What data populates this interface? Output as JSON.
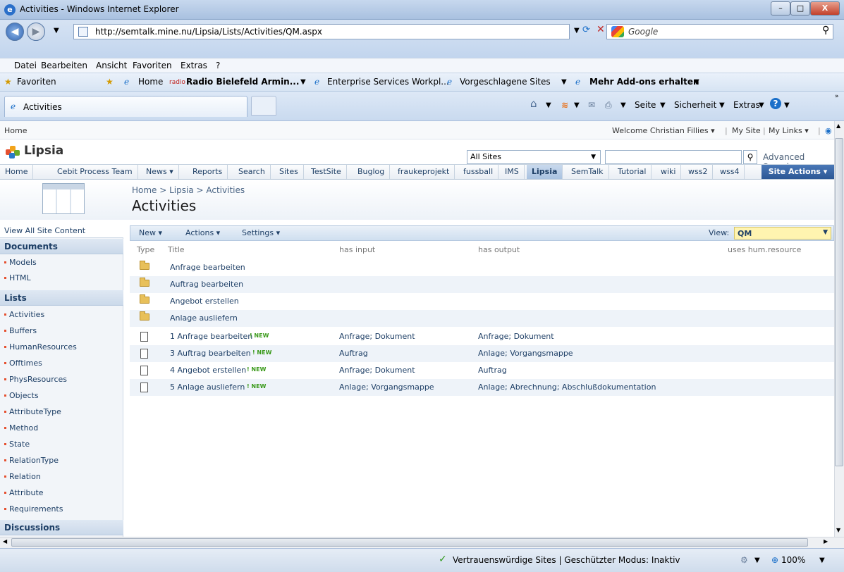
{
  "window": {
    "title": "Activities - Windows Internet Explorer",
    "minimize": "–",
    "maximize": "□",
    "close": "X"
  },
  "address": {
    "url": "http://semtalk.mine.nu/Lipsia/Lists/Activities/QM.aspx",
    "search_placeholder": "Google"
  },
  "menu": [
    "Datei",
    "Bearbeiten",
    "Ansicht",
    "Favoriten",
    "Extras",
    "?"
  ],
  "favorites": {
    "label": "Favoriten",
    "items": [
      "Home",
      "Radio Bielefeld Armin...",
      "Enterprise Services Workpl...",
      "Vorgeschlagene Sites",
      "Mehr Add-ons erhalten"
    ]
  },
  "tab": {
    "title": "Activities"
  },
  "commandbar": {
    "page": "Seite",
    "safety": "Sicherheit",
    "tools": "Extras"
  },
  "sp": {
    "breadcrumb_home": "Home",
    "welcome": "Welcome Christian Fillies ▾",
    "my_site": "My Site",
    "my_links": "My Links ▾",
    "site_title": "Lipsia",
    "scope": "All Sites",
    "advanced_search": "Advanced Search",
    "topnav": [
      "Home",
      "Cebit Process Team",
      "News ▾",
      "Reports",
      "Search",
      "Sites",
      "TestSite",
      "Buglog",
      "fraukeprojekt",
      "fussball",
      "IMS",
      "Lipsia",
      "SemTalk",
      "Tutorial",
      "wiki",
      "wss2",
      "wss4"
    ],
    "site_actions": "Site Actions ▾",
    "crumb": "Home > Lipsia > Activities",
    "page_title": "Activities"
  },
  "leftnav": {
    "view_all": "View All Site Content",
    "documents_header": "Documents",
    "documents": [
      "Models",
      "HTML"
    ],
    "lists_header": "Lists",
    "lists": [
      "Activities",
      "Buffers",
      "HumanResources",
      "Offtimes",
      "PhysResources",
      "Objects",
      "AttributeType",
      "Method",
      "State",
      "RelationType",
      "Relation",
      "Attribute",
      "Requirements"
    ],
    "discussions_header": "Discussions"
  },
  "toolbar": {
    "new": "New ▾",
    "actions": "Actions ▾",
    "settings": "Settings ▾",
    "view_label": "View:",
    "view_value": "QM"
  },
  "columns": {
    "type": "Type",
    "title": "Title",
    "has_input": "has input",
    "has_output": "has output",
    "uses": "uses hum.resource"
  },
  "rows": [
    {
      "kind": "folder",
      "title": "Anfrage bearbeiten",
      "input": "",
      "output": ""
    },
    {
      "kind": "folder",
      "title": "Auftrag bearbeiten",
      "input": "",
      "output": ""
    },
    {
      "kind": "folder",
      "title": "Angebot erstellen",
      "input": "",
      "output": ""
    },
    {
      "kind": "folder",
      "title": "Anlage ausliefern",
      "input": "",
      "output": ""
    },
    {
      "kind": "doc",
      "title": "1 Anfrage bearbeiten",
      "new": "! NEW",
      "input": "Anfrage; Dokument",
      "output": "Anfrage; Dokument"
    },
    {
      "kind": "doc",
      "title": "3 Auftrag bearbeiten",
      "new": "! NEW",
      "input": "Auftrag",
      "output": "Anlage; Vorgangsmappe"
    },
    {
      "kind": "doc",
      "title": "4 Angebot erstellen",
      "new": "! NEW",
      "input": "Anfrage; Dokument",
      "output": "Auftrag"
    },
    {
      "kind": "doc",
      "title": "5 Anlage ausliefern",
      "new": "! NEW",
      "input": "Anlage; Vorgangsmappe",
      "output": "Anlage; Abrechnung; Abschlußdokumentation"
    }
  ],
  "status": {
    "text": "Vertrauenswürdige Sites | Geschützter Modus: Inaktiv",
    "zoom": "100%"
  }
}
